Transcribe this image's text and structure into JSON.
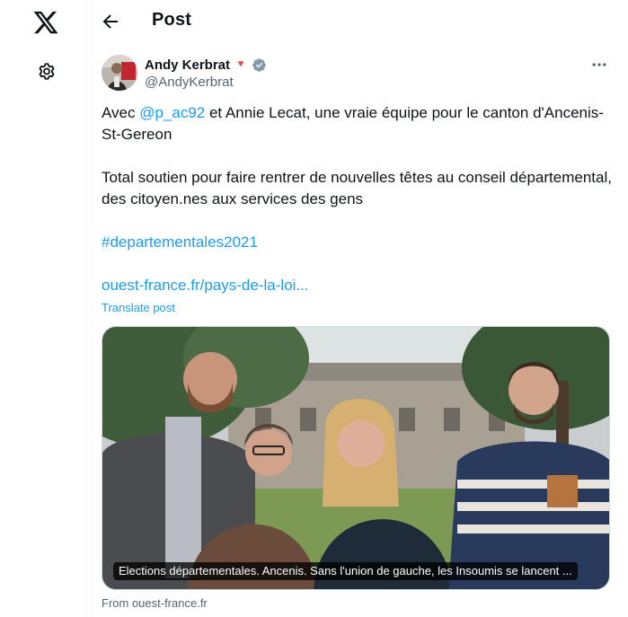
{
  "nav": {
    "logo_icon": "x-logo-icon",
    "settings_icon": "gear-icon"
  },
  "header": {
    "back_icon": "arrow-left-icon",
    "title": "Post"
  },
  "author": {
    "name": "Andy Kerbrat",
    "emoji": "🔻",
    "verified_icon": "verified-badge-icon",
    "handle": "@AndyKerbrat"
  },
  "post": {
    "line1_prefix": "Avec ",
    "mention": "@p_ac92",
    "line1_suffix": " et Annie Lecat, une vraie équipe pour le canton d'Ancenis-St-Gereon",
    "line2": "Total soutien pour faire rentrer de nouvelles têtes au conseil départemental, des citoyen.nes aux services des gens",
    "hashtag": "#departementales2021",
    "link": "ouest-france.fr/pays-de-la-loi...",
    "translate": "Translate post"
  },
  "card": {
    "caption": "Elections départementales. Ancenis. Sans l'union de gauche, les Insoumis se lancent ...",
    "source": "From ouest-france.fr"
  },
  "colors": {
    "accent": "#1d9bf0",
    "text": "#0f1419",
    "muted": "#536471",
    "border": "#cfd9de"
  }
}
